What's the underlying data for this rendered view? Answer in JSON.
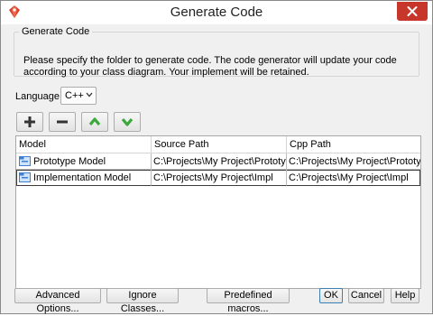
{
  "window": {
    "title": "Generate Code"
  },
  "group": {
    "legend": "Generate Code",
    "description": "Please specify the folder to generate code. The code generator will update your code according to your class diagram. Your implement will be retained."
  },
  "language": {
    "label": "Language:",
    "selected": "C++"
  },
  "toolbar": {
    "icons": [
      "add-icon",
      "remove-icon",
      "move-up-icon",
      "move-down-icon"
    ],
    "colors": {
      "add": "#333333",
      "up_down": "#3aa83a"
    }
  },
  "table": {
    "columns": [
      "Model",
      "Source Path",
      "Cpp Path"
    ],
    "rows": [
      {
        "model": "Prototype Model",
        "source": "C:\\Projects\\My Project\\Prototype",
        "cpp": "C:\\Projects\\My Project\\Prototype"
      },
      {
        "model": "Implementation Model",
        "source": "C:\\Projects\\My Project\\Impl",
        "cpp": "C:\\Projects\\My Project\\Impl"
      }
    ]
  },
  "buttons": {
    "advanced": "Advanced Options...",
    "ignore": "Ignore Classes...",
    "macros": "Predefined macros...",
    "ok": "OK",
    "cancel": "Cancel",
    "help": "Help"
  },
  "colors": {
    "close_button": "#c7362b",
    "selection_border": "#3c3c3c",
    "model_icon": "#3e7fcf"
  }
}
